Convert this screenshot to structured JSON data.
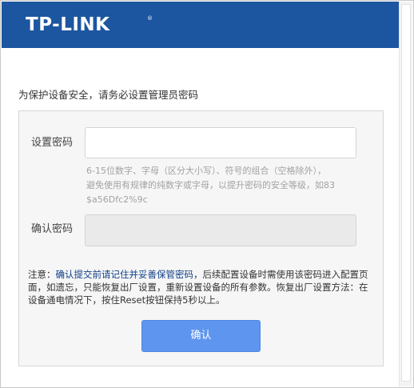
{
  "header": {
    "brand": "TP-LINK",
    "registered_mark": "®",
    "color": "#1c56a0"
  },
  "instruction": "为保护设备安全，请务必设置管理员密码",
  "form": {
    "password_label": "设置密码",
    "password_value": "",
    "hint_lines": [
      "6-15位数字、字母（区分大小写）、符号的组合（空格除外），",
      "避免使用有规律的纯数字或字母，以提升密码的安全等级，如83",
      "$a56Dfc2%9c"
    ],
    "confirm_label": "确认密码",
    "confirm_value": ""
  },
  "note": {
    "prefix": "注意：",
    "emphasis": "确认提交前请记住并妥善保管密码",
    "rest": "，后续配置设备时需使用该密码进入配置页面，如遗忘，只能恢复出厂设置，重新设置设备的所有参数。恢复出厂设置方法：在设备通电情况下，按住Reset按钮保持5秒以上。"
  },
  "submit": {
    "label": "确认",
    "color": "#5e95ee"
  }
}
